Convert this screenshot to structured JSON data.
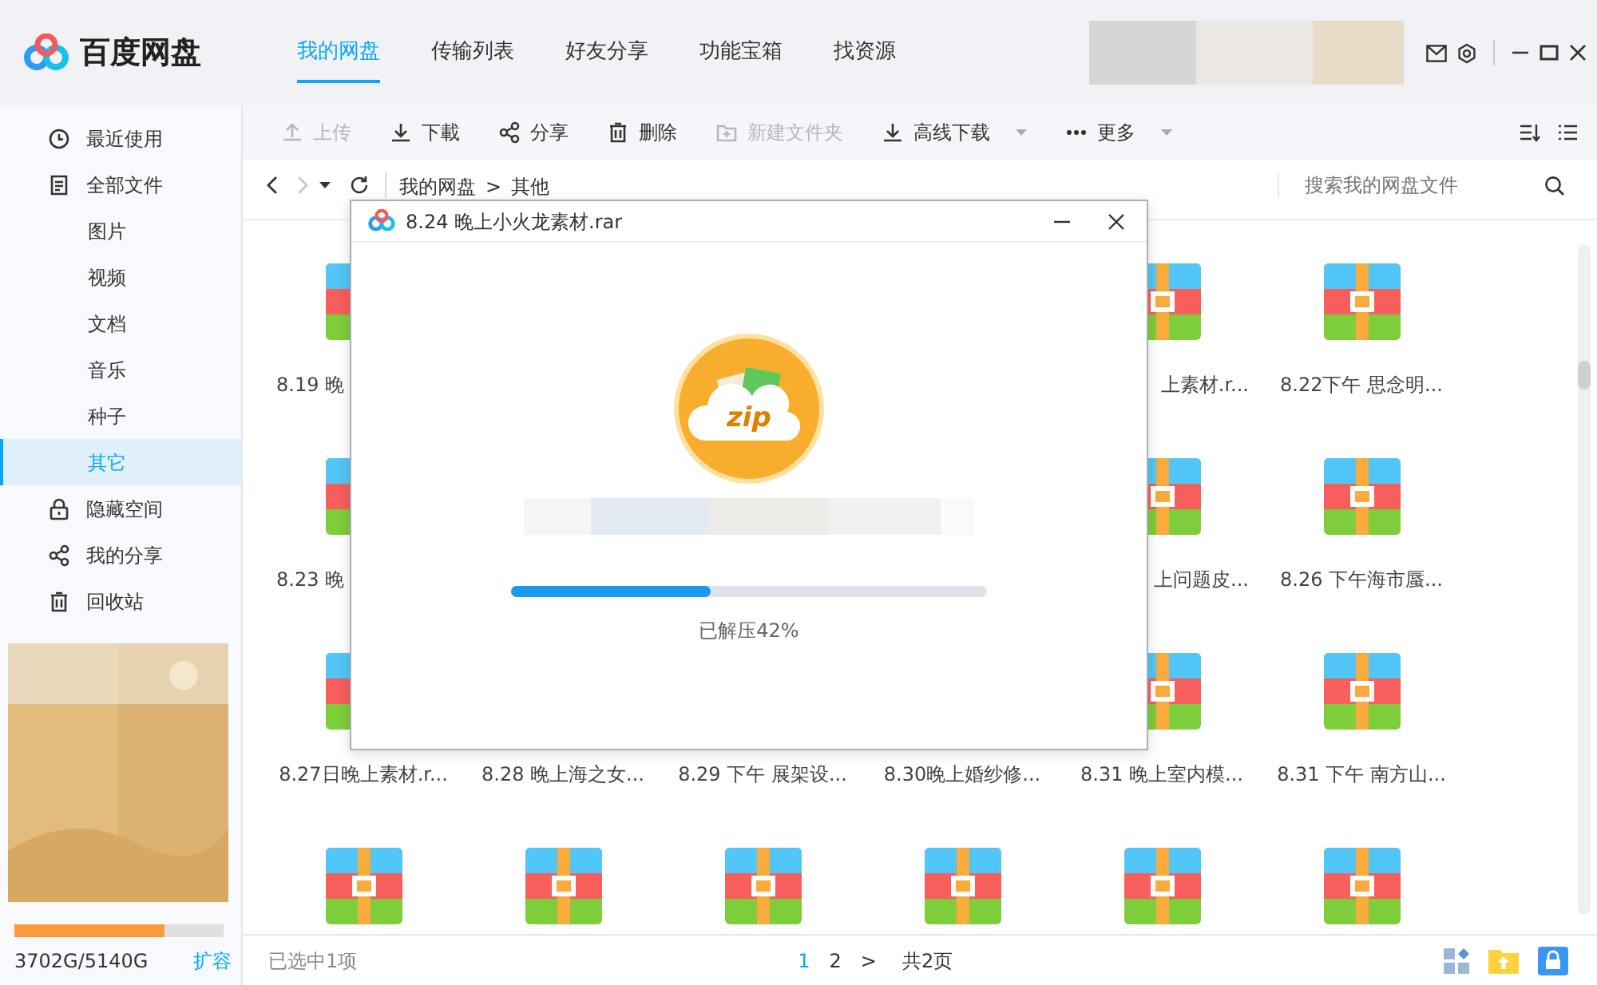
{
  "app": {
    "name": "百度网盘"
  },
  "tabs": [
    {
      "label": "我的网盘",
      "selected": true
    },
    {
      "label": "传输列表",
      "selected": false
    },
    {
      "label": "好友分享",
      "selected": false
    },
    {
      "label": "功能宝箱",
      "selected": false
    },
    {
      "label": "找资源",
      "selected": false
    }
  ],
  "header": {
    "kind": "picture"
  },
  "toolbar": [
    {
      "label": "上传",
      "disabled": true,
      "dropdown": false
    },
    {
      "label": "下載",
      "disabled": false,
      "dropdown": false
    },
    {
      "label": "分享",
      "disabled": false,
      "dropdown": false
    },
    {
      "label": "删除",
      "disabled": false,
      "dropdown": false
    },
    {
      "label": "新建文件夹",
      "disabled": true,
      "dropdown": false
    },
    {
      "label": "高线下载",
      "disabled": false,
      "dropdown": true
    },
    {
      "label": "更多",
      "disabled": false,
      "dropdown": true
    }
  ],
  "path": {
    "crumbs": [
      "我的网盘",
      ">",
      "其他"
    ],
    "forward_disabled": true
  },
  "search": {
    "placeholder": "搜索我的网盘文件"
  },
  "sidebar": {
    "items": [
      {
        "label": "最近使用",
        "selected": false
      },
      {
        "label": "全部文件",
        "selected": false,
        "children": [
          {
            "label": "图片",
            "selected": false
          },
          {
            "label": "视频",
            "selected": false
          },
          {
            "label": "文档",
            "selected": false
          },
          {
            "label": "音乐",
            "selected": false
          },
          {
            "label": "种子",
            "selected": false
          },
          {
            "label": "其它",
            "selected": true
          }
        ]
      },
      {
        "label": "隐藏空间",
        "selected": false
      },
      {
        "label": "我的分享",
        "selected": false
      },
      {
        "label": "回收站",
        "selected": false
      }
    ],
    "promo": {
      "kind": "picture"
    },
    "storage": {
      "level": 0.72,
      "text": "3702G/5140G",
      "action": "扩容"
    }
  },
  "files": [
    [
      {
        "kind": "archive",
        "label": "8.19 晚"
      },
      {
        "kind": "covered"
      },
      {
        "kind": "covered"
      },
      {
        "kind": "covered"
      },
      {
        "kind": "archive",
        "label": "上素材.r..."
      },
      {
        "kind": "archive",
        "label": "8.22下午 思念明..."
      }
    ],
    [
      {
        "kind": "archive",
        "label": "8.23 晚"
      },
      {
        "kind": "covered"
      },
      {
        "kind": "covered"
      },
      {
        "kind": "covered"
      },
      {
        "kind": "archive",
        "label": "上问题皮..."
      },
      {
        "kind": "archive",
        "label": "8.26 下午海市蜃..."
      }
    ],
    [
      {
        "kind": "archive",
        "label": "8.27日晚上素材.r..."
      },
      {
        "kind": "covered",
        "label": "8.28 晚上海之女..."
      },
      {
        "kind": "covered",
        "label": "8.29 下午 展架设..."
      },
      {
        "kind": "covered",
        "label": "8.30晚上婚纱修..."
      },
      {
        "kind": "archive",
        "label": "8.31 晚上室内模..."
      },
      {
        "kind": "archive",
        "label": "8.31 下午 南方山..."
      }
    ],
    [
      {
        "kind": "archive"
      },
      {
        "kind": "archive"
      },
      {
        "kind": "archive"
      },
      {
        "kind": "archive"
      },
      {
        "kind": "archive"
      },
      {
        "kind": "archive"
      }
    ]
  ],
  "dialog": {
    "title": "8.24 晚上小火龙素材.rar",
    "badge": "zip",
    "progress": {
      "level": 0.42
    },
    "status": "已解压42%"
  },
  "status_bar": {
    "selection": "已选中1项",
    "pages": [
      {
        "label": "1",
        "selected": true
      },
      {
        "label": "2",
        "selected": false
      }
    ],
    "next": ">",
    "total": "共2页"
  }
}
